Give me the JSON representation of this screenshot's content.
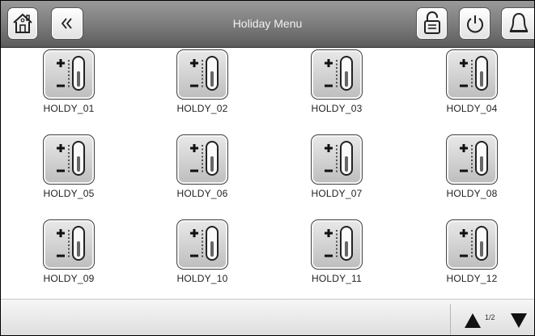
{
  "header": {
    "title": "Holiday Menu",
    "buttons": [
      {
        "name": "home-icon"
      },
      {
        "name": "back-chevron-icon"
      },
      {
        "name": "unlock-icon"
      },
      {
        "name": "power-icon"
      },
      {
        "name": "bell-icon"
      }
    ]
  },
  "grid": {
    "items": [
      {
        "label": "HOLDY_01",
        "icon": "thermometer-plus-minus-icon"
      },
      {
        "label": "HOLDY_02",
        "icon": "thermometer-plus-minus-icon"
      },
      {
        "label": "HOLDY_03",
        "icon": "thermometer-plus-minus-icon"
      },
      {
        "label": "HOLDY_04",
        "icon": "thermometer-plus-minus-icon"
      },
      {
        "label": "HOLDY_05",
        "icon": "thermometer-plus-minus-icon"
      },
      {
        "label": "HOLDY_06",
        "icon": "thermometer-plus-minus-icon"
      },
      {
        "label": "HOLDY_07",
        "icon": "thermometer-plus-minus-icon"
      },
      {
        "label": "HOLDY_08",
        "icon": "thermometer-plus-minus-icon"
      },
      {
        "label": "HOLDY_09",
        "icon": "thermometer-plus-minus-icon"
      },
      {
        "label": "HOLDY_10",
        "icon": "thermometer-plus-minus-icon"
      },
      {
        "label": "HOLDY_11",
        "icon": "thermometer-plus-minus-icon"
      },
      {
        "label": "HOLDY_12",
        "icon": "thermometer-plus-minus-icon"
      }
    ]
  },
  "footer": {
    "page_indicator": "1/2",
    "up_icon": "page-up-arrow-icon",
    "down_icon": "page-down-arrow-icon"
  }
}
